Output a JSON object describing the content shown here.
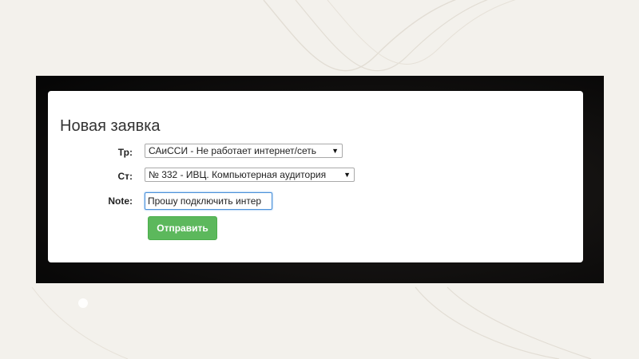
{
  "form": {
    "title": "Новая заявка",
    "fields": {
      "tr": {
        "label": "Тр:",
        "selected": "САиССИ - Не работает интернет/сеть"
      },
      "cr": {
        "label": "Ст:",
        "selected": "№ 332 - ИВЦ. Компьютерная аудитория"
      },
      "note": {
        "label": "Note:",
        "value": "Прошу подключить интер"
      }
    },
    "submit_label": "Отправить"
  },
  "colors": {
    "submit_button": "#5cb85c",
    "input_focus": "#4a90d9"
  },
  "icons": {
    "dropdown": "caret-down-icon"
  }
}
